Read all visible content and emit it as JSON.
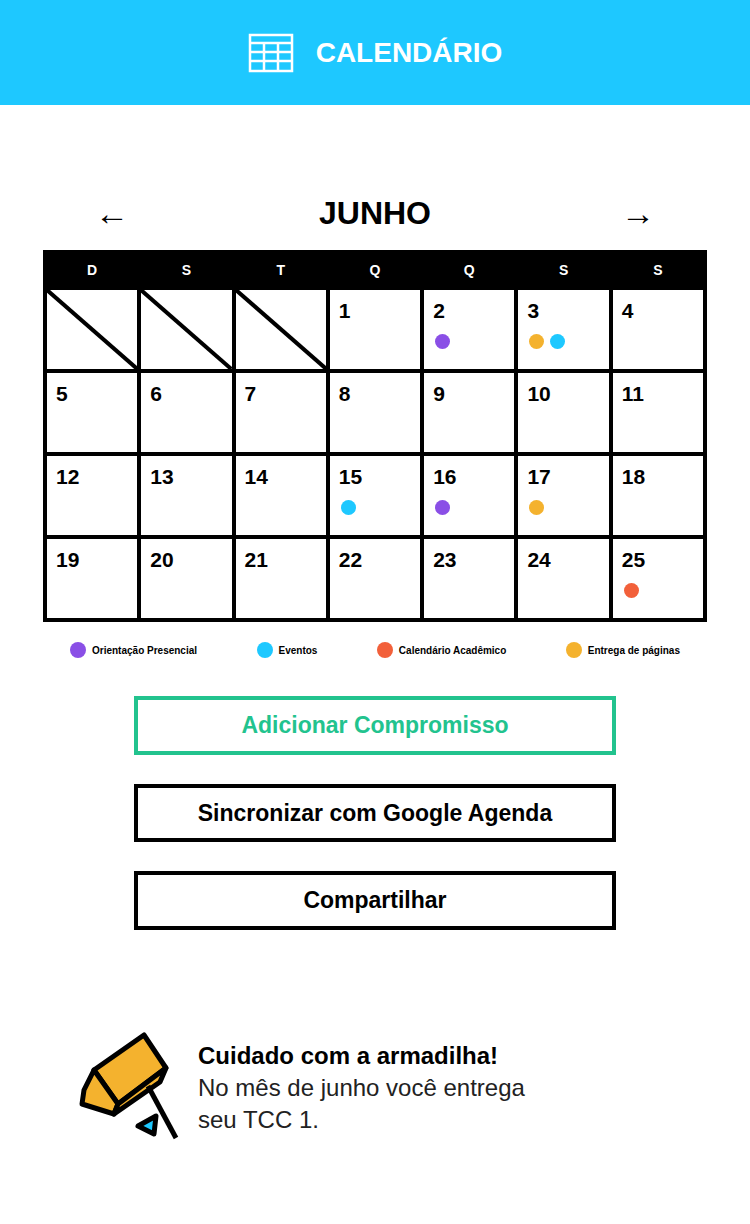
{
  "header": {
    "title": "CALENDÁRIO"
  },
  "month": {
    "label": "JUNHO",
    "prev": "←",
    "next": "→"
  },
  "weekdays": [
    "D",
    "S",
    "T",
    "Q",
    "Q",
    "S",
    "S"
  ],
  "weeks": [
    [
      {
        "day": "",
        "empty": true,
        "events": []
      },
      {
        "day": "",
        "empty": true,
        "events": []
      },
      {
        "day": "",
        "empty": true,
        "events": []
      },
      {
        "day": "1",
        "empty": false,
        "events": []
      },
      {
        "day": "2",
        "empty": false,
        "events": [
          {
            "color": "#8a4fe6"
          }
        ]
      },
      {
        "day": "3",
        "empty": false,
        "events": [
          {
            "color": "#f4b22e"
          },
          {
            "color": "#1ec8ff"
          }
        ]
      },
      {
        "day": "4",
        "empty": false,
        "events": []
      }
    ],
    [
      {
        "day": "5",
        "empty": false,
        "events": []
      },
      {
        "day": "6",
        "empty": false,
        "events": []
      },
      {
        "day": "7",
        "empty": false,
        "events": []
      },
      {
        "day": "8",
        "empty": false,
        "events": []
      },
      {
        "day": "9",
        "empty": false,
        "events": []
      },
      {
        "day": "10",
        "empty": false,
        "events": []
      },
      {
        "day": "11",
        "empty": false,
        "events": []
      }
    ],
    [
      {
        "day": "12",
        "empty": false,
        "events": []
      },
      {
        "day": "13",
        "empty": false,
        "events": []
      },
      {
        "day": "14",
        "empty": false,
        "events": []
      },
      {
        "day": "15",
        "empty": false,
        "events": [
          {
            "color": "#1ec8ff"
          }
        ]
      },
      {
        "day": "16",
        "empty": false,
        "events": [
          {
            "color": "#8a4fe6"
          }
        ]
      },
      {
        "day": "17",
        "empty": false,
        "events": [
          {
            "color": "#f4b22e"
          }
        ]
      },
      {
        "day": "18",
        "empty": false,
        "events": []
      }
    ],
    [
      {
        "day": "19",
        "empty": false,
        "events": []
      },
      {
        "day": "20",
        "empty": false,
        "events": []
      },
      {
        "day": "21",
        "empty": false,
        "events": []
      },
      {
        "day": "22",
        "empty": false,
        "events": []
      },
      {
        "day": "23",
        "empty": false,
        "events": []
      },
      {
        "day": "24",
        "empty": false,
        "events": []
      },
      {
        "day": "25",
        "empty": false,
        "events": [
          {
            "color": "#f2603a"
          }
        ]
      }
    ]
  ],
  "legend": [
    {
      "label": "Orientação Presencial",
      "color": "#8a4fe6"
    },
    {
      "label": "Eventos",
      "color": "#1ec8ff"
    },
    {
      "label": "Calendário Acadêmico",
      "color": "#f2603a"
    },
    {
      "label": "Entrega de páginas",
      "color": "#f4b22e"
    }
  ],
  "buttons": [
    {
      "label": "Adicionar Compromisso",
      "kind": "primary"
    },
    {
      "label": "Sincronizar com Google Agenda",
      "kind": "default"
    },
    {
      "label": "Compartilhar",
      "kind": "default"
    }
  ],
  "tip": {
    "title": "Cuidado com a armadilha!",
    "body": "No mês de junho você entrega seu TCC 1."
  }
}
